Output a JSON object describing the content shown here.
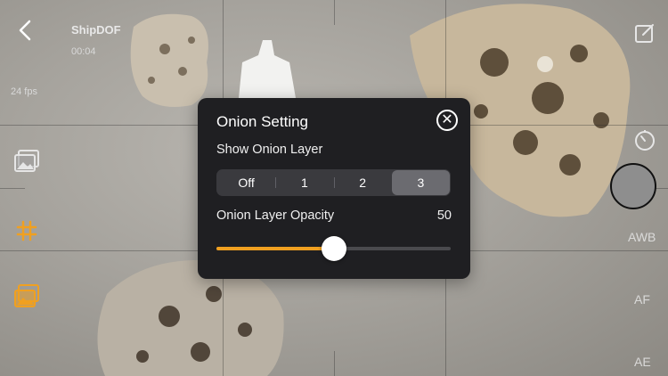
{
  "project": {
    "name": "ShipDOF",
    "time": "00:04",
    "fps": "24 fps"
  },
  "right_bar": {
    "awb_label": "AWB",
    "af_label": "AF",
    "ae_label": "AE"
  },
  "onion_panel": {
    "title": "Onion Setting",
    "show_layer_label": "Show Onion Layer",
    "layer_options": [
      "Off",
      "1",
      "2",
      "3"
    ],
    "selected_option": "3",
    "opacity_label": "Onion Layer Opacity",
    "opacity_value": "50",
    "opacity_fraction": 0.5
  },
  "colors": {
    "accent": "#f0a020",
    "panel_bg": "#1f1f22",
    "segment_selected": "#6b6b70"
  },
  "icons": [
    "back-chevron-icon",
    "gallery-icon",
    "grid-icon",
    "onion-layers-icon",
    "edit-icon",
    "timer-icon",
    "close-icon"
  ]
}
